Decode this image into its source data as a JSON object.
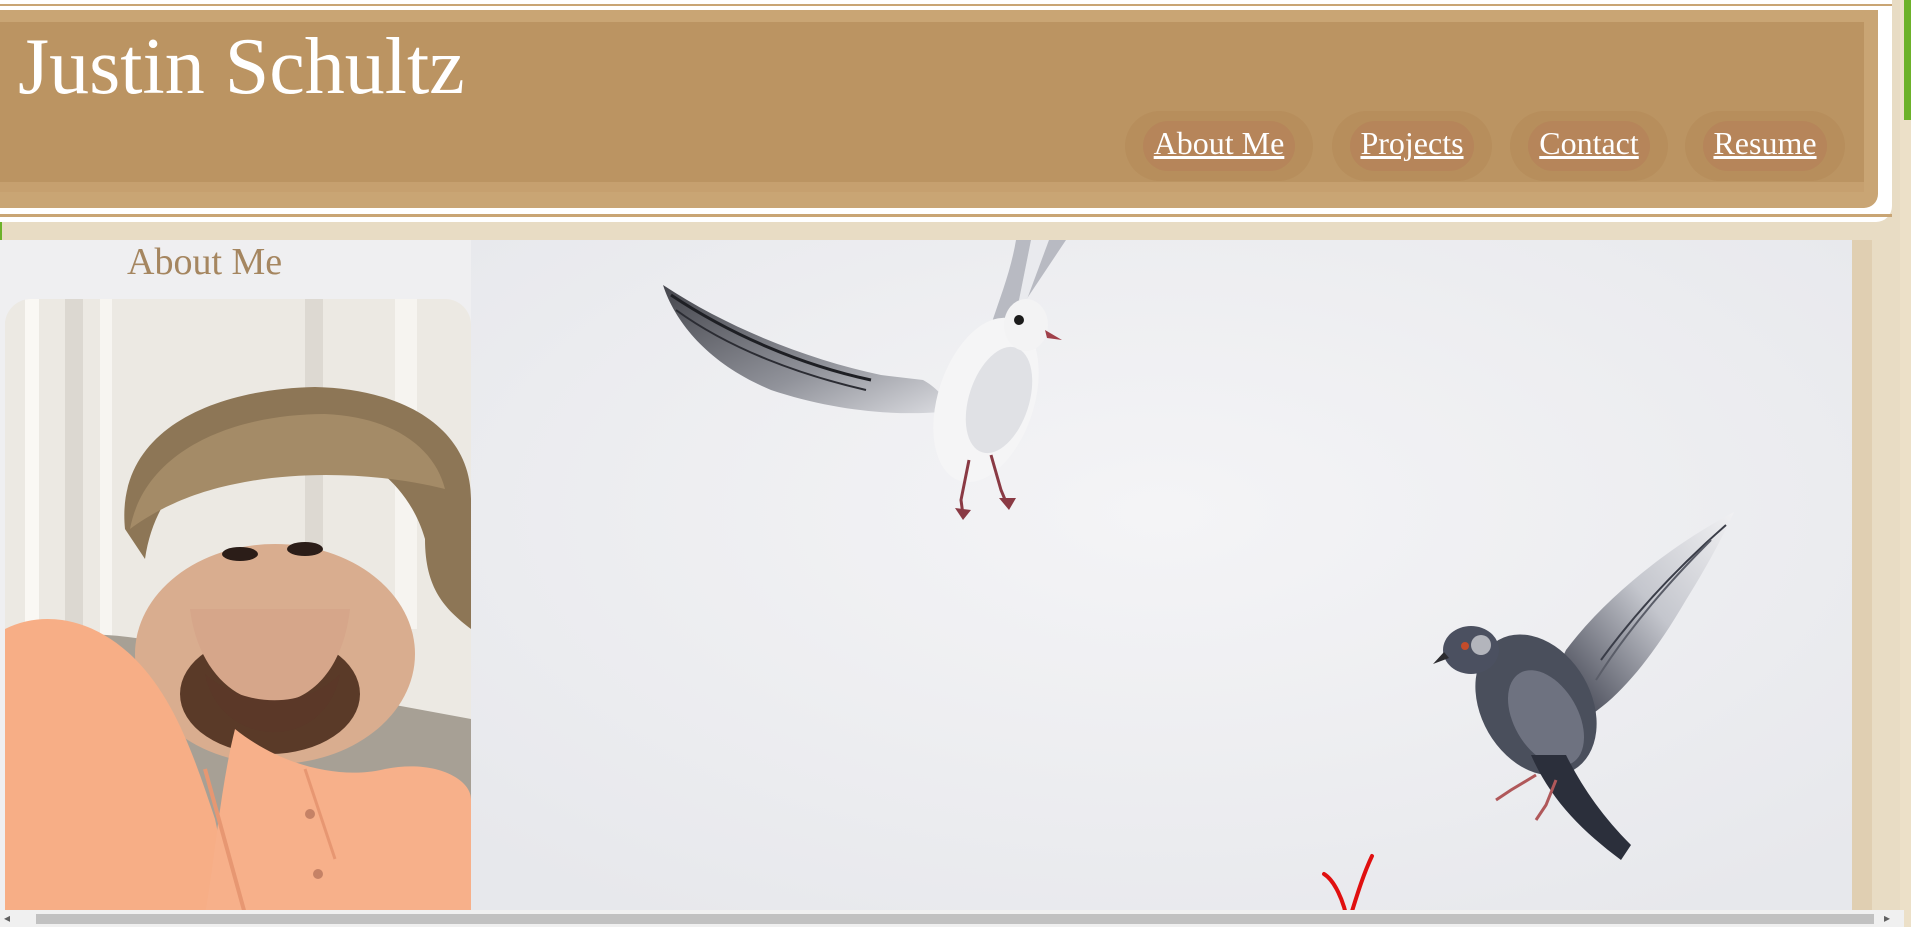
{
  "site": {
    "title": "Justin Schultz"
  },
  "nav": {
    "items": [
      {
        "label": "About Me"
      },
      {
        "label": "Projects"
      },
      {
        "label": "Contact"
      },
      {
        "label": "Resume"
      }
    ]
  },
  "main": {
    "section_heading": "About Me",
    "profile_photo": {
      "icon": "portrait-photo"
    },
    "background_image": {
      "icon": "birds-in-flight-photo"
    }
  },
  "colors": {
    "header": "#bb9462",
    "header_light": "#c9a574",
    "nav_pill": "#b78e5c",
    "page_bg": "#e8dcc4",
    "heading": "#a58660",
    "annotation": "#e01010"
  },
  "scrollbar": {
    "left_arrow": "◂",
    "right_arrow": "▸"
  }
}
